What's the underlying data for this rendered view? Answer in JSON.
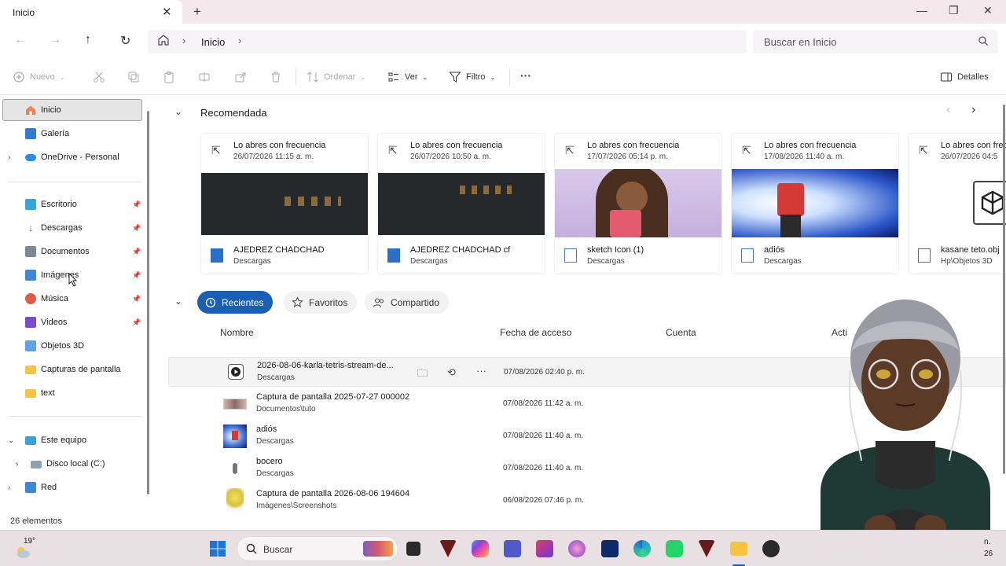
{
  "window": {
    "tab_title": "Inicio",
    "close_tab": "✕",
    "new_tab": "+",
    "minimize": "—",
    "maximize": "❐",
    "close": "✕"
  },
  "address": {
    "breadcrumb": "Inicio",
    "search_placeholder": "Buscar en Inicio"
  },
  "toolbar": {
    "new_label": "Nuevo",
    "sort_label": "Ordenar",
    "view_label": "Ver",
    "filter_label": "Filtro",
    "more_label": "···",
    "details_label": "Detalles"
  },
  "sidebar": {
    "items": [
      {
        "label": "Inicio",
        "icon": "home-icon"
      },
      {
        "label": "Galería",
        "icon": "gallery-icon"
      },
      {
        "label": "OneDrive - Personal",
        "icon": "cloud-icon"
      },
      {
        "label": "Escritorio",
        "icon": "desktop-icon"
      },
      {
        "label": "Descargas",
        "icon": "download-icon"
      },
      {
        "label": "Documentos",
        "icon": "documents-icon"
      },
      {
        "label": "Imágenes",
        "icon": "pictures-icon"
      },
      {
        "label": "Música",
        "icon": "music-icon"
      },
      {
        "label": "Videos",
        "icon": "videos-icon"
      },
      {
        "label": "Objetos 3D",
        "icon": "3d-objects-icon"
      },
      {
        "label": "Capturas de pantalla",
        "icon": "folder-icon"
      },
      {
        "label": "text",
        "icon": "folder-icon"
      },
      {
        "label": "Este equipo",
        "icon": "computer-icon"
      },
      {
        "label": "Disco local (C:)",
        "icon": "drive-icon"
      },
      {
        "label": "Red",
        "icon": "network-icon"
      }
    ],
    "status": "26 elementos"
  },
  "recommended": {
    "title": "Recomendada",
    "cards": [
      {
        "reason": "Lo abres con frecuencia",
        "date": "26/07/2026 11:15 a. m.",
        "name": "AJEDREZ CHADCHAD",
        "location": "Descargas"
      },
      {
        "reason": "Lo abres con frecuencia",
        "date": "26/07/2026 10:50 a. m.",
        "name": "AJEDREZ CHADCHAD cf",
        "location": "Descargas"
      },
      {
        "reason": "Lo abres con frecuencia",
        "date": "17/07/2026 05:14 p. m.",
        "name": "sketch Icon (1)",
        "location": "Descargas"
      },
      {
        "reason": "Lo abres con frecuencia",
        "date": "17/08/2026 11:40 a. m.",
        "name": "adiós",
        "location": "Descargas"
      },
      {
        "reason": "Lo abres con frecuencia",
        "date": "26/07/2026 04:5",
        "name": "kasane teto.obj",
        "location": "Hp\\Objetos 3D"
      }
    ]
  },
  "files": {
    "tabs": [
      "Recientes",
      "Favoritos",
      "Compartido"
    ],
    "columns": [
      "Nombre",
      "Fecha de acceso",
      "Cuenta",
      "Acti"
    ],
    "rows": [
      {
        "name": "2026-08-06-karla-tetris-stream-de...",
        "location": "Descargas",
        "date": "07/08/2026 02:40 p. m."
      },
      {
        "name": "Captura de pantalla 2025-07-27 000002",
        "location": "Documentos\\tuto",
        "date": "07/08/2026 11:42 a. m."
      },
      {
        "name": "adiós",
        "location": "Descargas",
        "date": "07/08/2026 11:40 a. m."
      },
      {
        "name": "bocero",
        "location": "Descargas",
        "date": "07/08/2026 11:40 a. m."
      },
      {
        "name": "Captura de pantalla 2026-08-06 194604",
        "location": "Imágenes\\Screenshots",
        "date": "06/08/2026 07:46 p. m."
      }
    ]
  },
  "taskbar": {
    "weather": "19°",
    "search_label": "Buscar",
    "clock_partial_1": "n.",
    "clock_partial_2": "26"
  },
  "colors": {
    "accent": "#1a5fb4",
    "titlebar": "#f3e9ec",
    "taskbar": "#e9e0e4"
  }
}
